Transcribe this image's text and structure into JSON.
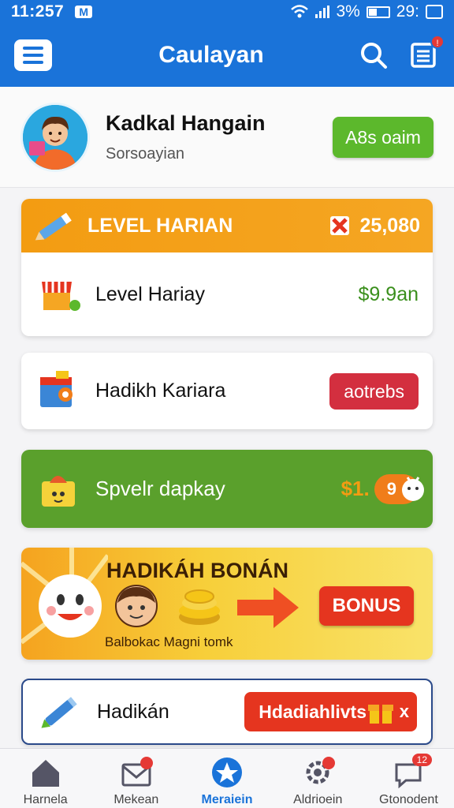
{
  "status": {
    "time": "11:257",
    "battery_text": "3%",
    "clock_right": "29:"
  },
  "header": {
    "title": "Caulayan"
  },
  "profile": {
    "name": "Kadkal Hangain",
    "subtitle": "Sorsoayian",
    "action_label": "A8s oaim"
  },
  "level_card": {
    "title": "LEVEL HARIAN",
    "points": "25,080",
    "row_label": "Level Hariay",
    "row_value": "$9.9an"
  },
  "hadiah_card": {
    "label": "Hadikh Kariara",
    "button_label": "aotrebs"
  },
  "green_card": {
    "label": "Spvelr dapkay",
    "amount": "$1.",
    "pill_value": "9"
  },
  "bonus_card": {
    "title": "HADIKÁH BONÁN",
    "subtitle": "Balbokac Magni tomk",
    "button_label": "BONUS"
  },
  "last_card": {
    "label": "Hadikán",
    "button_label": "Hdadiahlivts",
    "close": "x"
  },
  "nav": {
    "items": [
      {
        "label": "Harnela",
        "icon": "home-icon"
      },
      {
        "label": "Mekean",
        "icon": "mail-icon"
      },
      {
        "label": "Meraiein",
        "icon": "star-icon"
      },
      {
        "label": "Aldrioein",
        "icon": "settings-icon"
      },
      {
        "label": "Gtonodent",
        "icon": "message-icon",
        "badge": "12"
      }
    ]
  },
  "colors": {
    "brand": "#1a73d9",
    "accent_green": "#5cb82c",
    "accent_orange": "#f39c12",
    "accent_red": "#e5351f"
  }
}
